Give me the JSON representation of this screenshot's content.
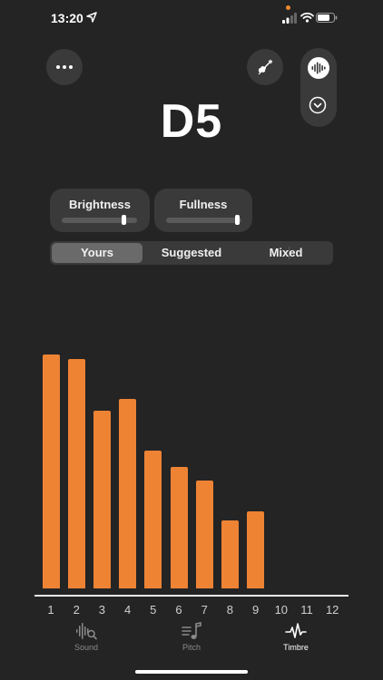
{
  "status": {
    "time": "13:20",
    "icons": [
      "location-arrow-icon",
      "signal-icon",
      "wifi-icon",
      "battery-icon"
    ]
  },
  "toolbar": {
    "more_icon": "ellipsis-icon",
    "instrument_icon": "violin-tuner-icon",
    "listen_icon": "waveform-icon",
    "collapse_icon": "chevron-down-circle-icon"
  },
  "note": "D5",
  "sliders": {
    "brightness": {
      "label": "Brightness",
      "value": 0.85
    },
    "fullness": {
      "label": "Fullness",
      "value": 0.97
    }
  },
  "segments": {
    "options": [
      "Yours",
      "Suggested",
      "Mixed"
    ],
    "selected": "Yours"
  },
  "chart_data": {
    "type": "bar",
    "categories": [
      "1",
      "2",
      "3",
      "4",
      "5",
      "6",
      "7",
      "8",
      "9",
      "10",
      "11",
      "12"
    ],
    "values": [
      1.0,
      0.98,
      0.76,
      0.81,
      0.59,
      0.52,
      0.46,
      0.29,
      0.33,
      0,
      0,
      0
    ],
    "bar_color": "#ee8334",
    "ylim": [
      0,
      1
    ]
  },
  "tabs": [
    {
      "label": "Sound",
      "icon": "waveform-search-icon",
      "active": false
    },
    {
      "label": "Pitch",
      "icon": "music-note-list-icon",
      "active": false
    },
    {
      "label": "Timbre",
      "icon": "pulse-wave-icon",
      "active": true
    }
  ],
  "colors": {
    "accent": "#ee8334",
    "background": "#242424"
  }
}
